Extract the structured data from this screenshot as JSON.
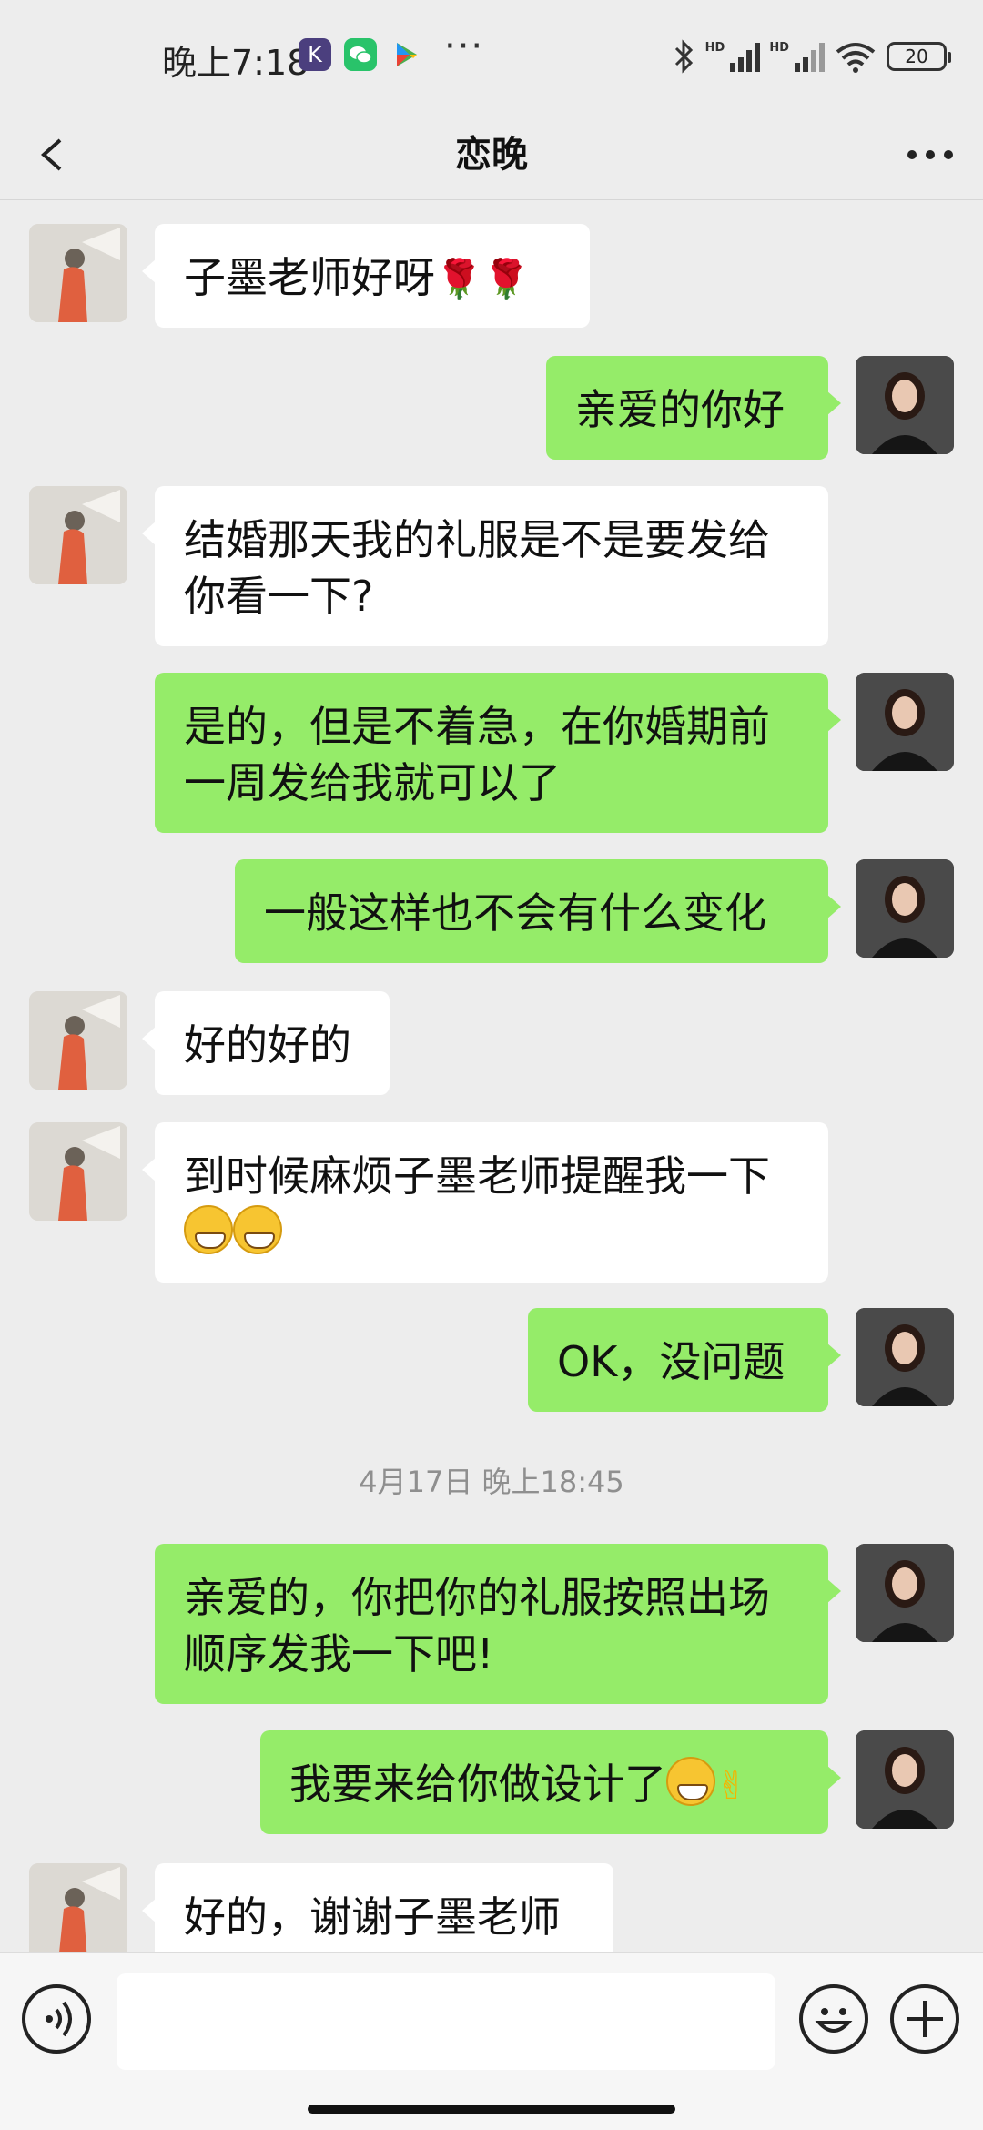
{
  "status_bar": {
    "time": "晚上7:18",
    "app_k_label": "K",
    "more": "···",
    "battery": "20"
  },
  "nav": {
    "title": "恋晚"
  },
  "messages": [
    {
      "side": "left",
      "text": "子墨老师好呀",
      "suffix": "rose-rose"
    },
    {
      "side": "right",
      "text": "亲爱的你好"
    },
    {
      "side": "left",
      "text": "结婚那天我的礼服是不是要发给你看一下?"
    },
    {
      "side": "right",
      "text": "是的，但是不着急，在你婚期前一周发给我就可以了"
    },
    {
      "side": "right",
      "text": "一般这样也不会有什么变化"
    },
    {
      "side": "left",
      "text": "好的好的"
    },
    {
      "side": "left",
      "text": "到时候麻烦子墨老师提醒我一下",
      "suffix": "grin-grin"
    },
    {
      "side": "right",
      "text": "OK，没问题"
    },
    {
      "side": "right",
      "text": "亲爱的，你把你的礼服按照出场顺序发我一下吧!"
    },
    {
      "side": "right",
      "text": "我要来给你做设计了",
      "suffix": "grin-victory"
    },
    {
      "side": "left",
      "text": "好的，谢谢子墨老师"
    }
  ],
  "timestamp": "4月17日 晚上18:45",
  "icons": {
    "back": "chevron-left-icon",
    "more": "more-horizontal-icon",
    "voice": "voice-icon",
    "emoji": "emoji-icon",
    "plus": "plus-icon"
  },
  "colors": {
    "background": "#ededed",
    "sent_bubble": "#95ec69",
    "received_bubble": "#ffffff"
  }
}
